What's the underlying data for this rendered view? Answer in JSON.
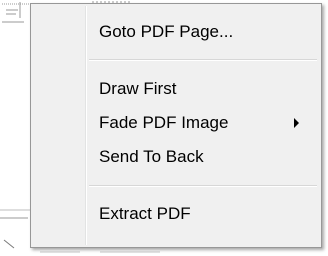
{
  "context_menu": {
    "items": [
      {
        "label": "Goto PDF Page...",
        "has_submenu": false
      },
      {
        "label": "Draw First",
        "has_submenu": false
      },
      {
        "label": "Fade PDF Image",
        "has_submenu": true
      },
      {
        "label": "Send To Back",
        "has_submenu": false
      },
      {
        "label": "Extract PDF",
        "has_submenu": false
      }
    ]
  },
  "colors": {
    "menu_background": "#f0f0f0",
    "menu_border": "#979797",
    "separator": "#d7d7d7",
    "text": "#000000"
  },
  "icons": {
    "submenu_indicator": "chevron-right-icon"
  }
}
